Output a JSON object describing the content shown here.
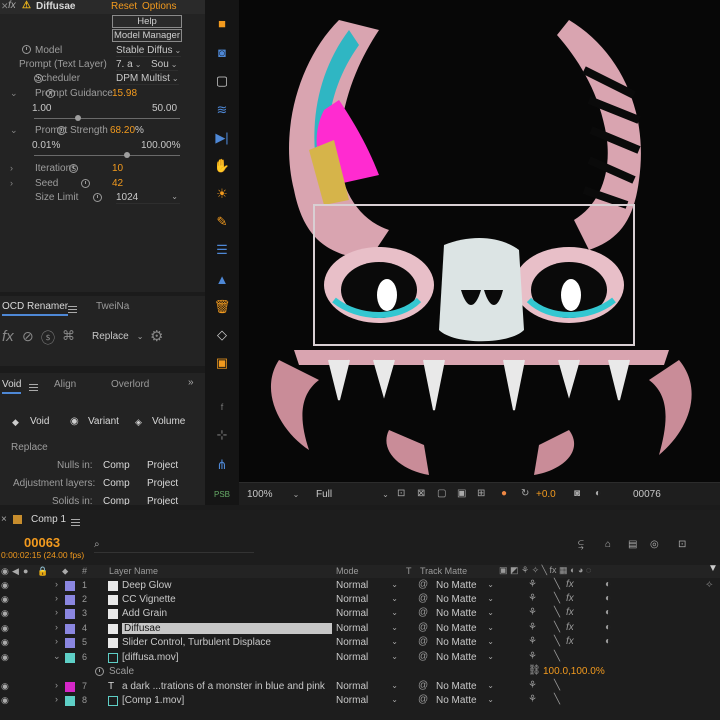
{
  "fx_panel": {
    "effect_name": "Diffusae",
    "reset_label": "Reset",
    "options_label": "Options",
    "help_label": "Help",
    "model_manager_label": "Model Manager",
    "params": {
      "model_label": "Model",
      "model_value": "Stable Diffus",
      "prompt_label": "Prompt (Text Layer)",
      "prompt_value": "7. a",
      "prompt_source": "Sou",
      "scheduler_label": "Scheduler",
      "scheduler_value": "DPM Multist",
      "guidance_label": "Prompt Guidance",
      "guidance_value": "15.98",
      "guidance_min": "1.00",
      "guidance_max": "50.00",
      "strength_label": "Prompt Strength",
      "strength_value": "68.20",
      "strength_unit": "%",
      "strength_min": "0.01%",
      "strength_max": "100.00%",
      "iterations_label": "Iterations",
      "iterations_value": "10",
      "seed_label": "Seed",
      "seed_value": "42",
      "size_label": "Size Limit",
      "size_value": "1024"
    }
  },
  "ocd_panel": {
    "tab_active": "OCD Renamer",
    "tab_inactive": "TweiNa",
    "replace_label": "Replace"
  },
  "void_panel": {
    "tab_active": "Void",
    "tab_align": "Align",
    "tab_overlord": "Overlord",
    "radio_void": "Void",
    "radio_variant": "Variant",
    "radio_volume": "Volume",
    "replace_heading": "Replace",
    "nulls_label": "Nulls in:",
    "adjust_label": "Adjustment layers:",
    "solids_label": "Solids in:",
    "comp_label": "Comp",
    "project_label": "Project"
  },
  "viewer_bar": {
    "zoom": "100%",
    "resolution": "Full",
    "exposure": "+0.0",
    "frame": "00076"
  },
  "timeline": {
    "comp_tab": "Comp 1",
    "timecode": "00063",
    "timecode_sub": "0:00:02:15 (24.00 fps)",
    "search_placeholder": "",
    "col_num": "#",
    "col_layer_name": "Layer Name",
    "col_mode": "Mode",
    "col_t": "T",
    "col_track_matte": "Track Matte",
    "layers": [
      {
        "num": "1",
        "name": "Deep Glow",
        "mode": "Normal",
        "matte": "No Matte",
        "color": "#8a86e0"
      },
      {
        "num": "2",
        "name": "CC Vignette",
        "mode": "Normal",
        "matte": "No Matte",
        "color": "#8a86e0"
      },
      {
        "num": "3",
        "name": "Add Grain",
        "mode": "Normal",
        "matte": "No Matte",
        "color": "#8a86e0"
      },
      {
        "num": "4",
        "name": "Diffusae",
        "mode": "Normal",
        "matte": "No Matte",
        "color": "#8a86e0"
      },
      {
        "num": "5",
        "name": "Slider Control, Turbulent Displace",
        "mode": "Normal",
        "matte": "No Matte",
        "color": "#8a86e0"
      },
      {
        "num": "6",
        "name": "[diffusa.mov]",
        "mode": "Normal",
        "matte": "No Matte",
        "color": "#5ecfc6"
      },
      {
        "num": "7",
        "name": "a dark ...trations of a monster in blue and pink",
        "mode": "Normal",
        "matte": "No Matte",
        "color": "#d627c8"
      },
      {
        "num": "8",
        "name": "[Comp 1.mov]",
        "mode": "Normal",
        "matte": "No Matte",
        "color": "#5ecfc6"
      }
    ],
    "scale_label": "Scale",
    "scale_value": "100.0,100.0%"
  },
  "colors": {
    "accent_orange": "#f29a1e",
    "accent_blue": "#4e88d6",
    "warning_yellow": "#e8b21b"
  }
}
